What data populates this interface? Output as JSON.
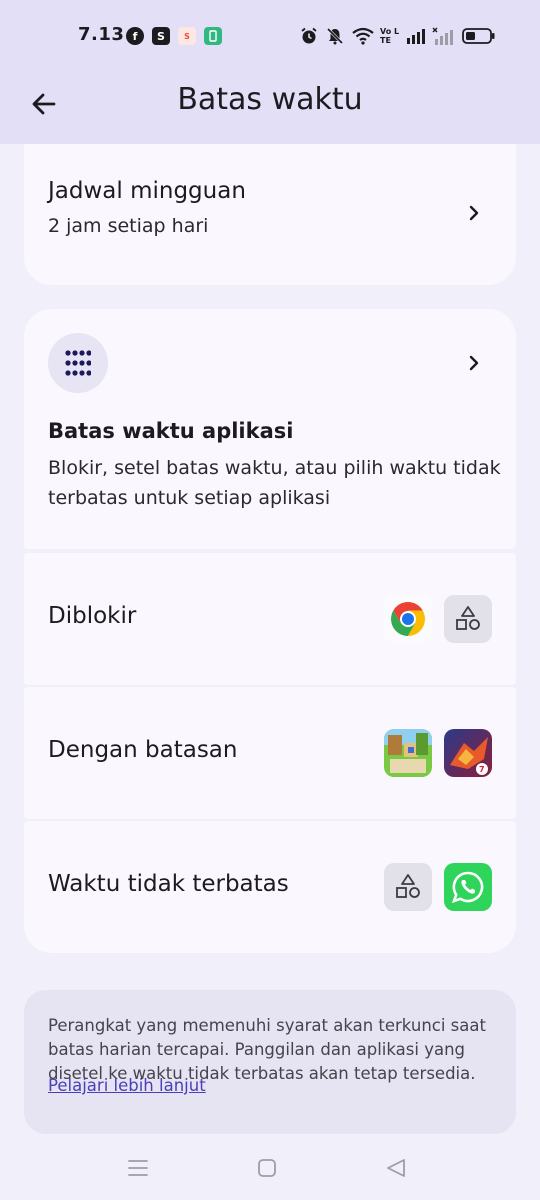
{
  "status_bar": {
    "time": "7.13",
    "left_icons": [
      "facebook-icon",
      "shopee-icon",
      "shopeepay-icon",
      "battery-saver-icon"
    ],
    "right_icons": [
      "alarm-icon",
      "mute-icon",
      "wifi-icon",
      "volte-icon",
      "signal-icon",
      "signal-x-icon",
      "battery-icon"
    ],
    "volte_label": "Vo LTE",
    "colors": {
      "facebook": "#1c1b1f",
      "shopee": "#1c1b1f",
      "shopeepay": "#ee4d2d",
      "battery_saver": "#2fb880"
    }
  },
  "app_bar": {
    "back_icon": "arrow-back-icon",
    "title": "Batas waktu"
  },
  "weekly": {
    "title": "Jadwal mingguan",
    "subtitle": "2 jam setiap hari"
  },
  "app_limits": {
    "icon": "apps-grid-icon",
    "title": "Batas waktu aplikasi",
    "description": "Blokir, setel batas waktu, atau pilih waktu tidak terbatas untuk setiap aplikasi"
  },
  "rows": [
    {
      "label": "Diblokir",
      "apps": [
        "chrome-app-icon",
        "generic-app-icon"
      ]
    },
    {
      "label": "Dengan batasan",
      "apps": [
        "block-craft-game-icon",
        "free-fire-game-icon"
      ]
    },
    {
      "label": "Waktu tidak terbatas",
      "apps": [
        "generic-app-icon",
        "whatsapp-app-icon"
      ]
    }
  ],
  "info": {
    "text": "Perangkat yang memenuhi syarat akan terkunci saat batas harian tercapai. Panggilan dan aplikasi yang disetel ke waktu tidak terbatas akan tetap tersedia.",
    "link": "Pelajari lebih lanjut"
  },
  "nav_bar": {
    "icons": [
      "menu-icon",
      "home-icon",
      "back-triangle-icon"
    ]
  },
  "colors": {
    "header_bg": "#e3dff7",
    "page_bg": "#f1effa",
    "card_bg": "#faf8fe",
    "accent": "#1a1a5c",
    "link": "#4a3fb8",
    "whatsapp": "#2fd45b"
  }
}
